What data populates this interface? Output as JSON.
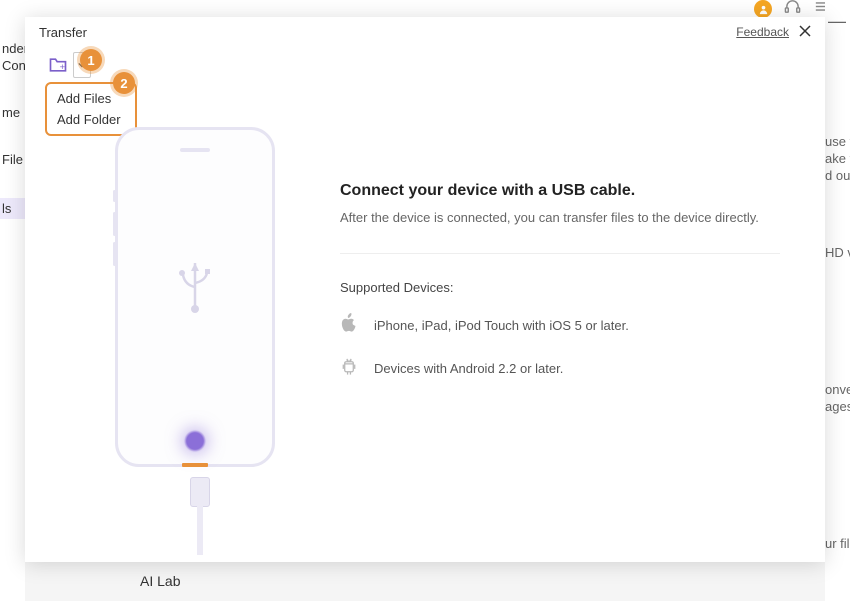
{
  "background_sidebar": {
    "i0": "nder",
    "i1": "Con",
    "i2": "me",
    "i3": "File",
    "i4": "ls"
  },
  "background_right": {
    "i0": "—",
    "i1": "use v",
    "i2": "ake y",
    "i3": "d our",
    "i4": "HD v",
    "i5": "onve",
    "i6": "ages",
    "i7": "ur file"
  },
  "background_bottom": "AI Lab",
  "modal": {
    "title": "Transfer",
    "feedback": "Feedback"
  },
  "callouts": {
    "one": "1",
    "two": "2"
  },
  "dropdown": {
    "add_files": "Add Files",
    "add_folder": "Add Folder"
  },
  "content": {
    "heading": "Connect your device with a USB cable.",
    "subtext": "After the device is connected, you can transfer files to the device directly.",
    "supported_label": "Supported Devices:",
    "ios_text": "iPhone, iPad, iPod Touch with iOS 5 or later.",
    "android_text": "Devices with Android 2.2 or later."
  }
}
